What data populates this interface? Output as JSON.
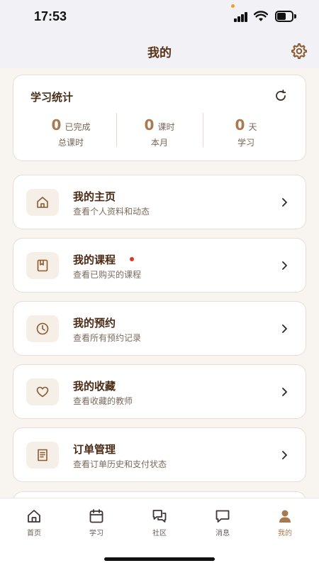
{
  "status": {
    "time": "17:53"
  },
  "header": {
    "title": "我的",
    "settings_icon": "gear-icon"
  },
  "stats": {
    "title": "学习统计",
    "items": [
      {
        "value": "0",
        "unit": "已完成",
        "label": "总课时"
      },
      {
        "value": "0",
        "unit": "课时",
        "label": "本月"
      },
      {
        "value": "0",
        "unit": "天",
        "label": "学习"
      }
    ]
  },
  "menu": [
    {
      "title": "我的主页",
      "subtitle": "查看个人资料和动态",
      "icon": "home-icon"
    },
    {
      "title": "我的课程",
      "subtitle": "查看已购买的课程",
      "icon": "book-icon",
      "badge": true
    },
    {
      "title": "我的预约",
      "subtitle": "查看所有预约记录",
      "icon": "clock-icon"
    },
    {
      "title": "我的收藏",
      "subtitle": "查看收藏的教师",
      "icon": "heart-icon"
    },
    {
      "title": "订单管理",
      "subtitle": "查看订单历史和支付状态",
      "icon": "receipt-icon"
    }
  ],
  "tabs": [
    {
      "label": "首页",
      "icon": "home-icon"
    },
    {
      "label": "学习",
      "icon": "calendar-icon"
    },
    {
      "label": "社区",
      "icon": "chat-bubbles-icon"
    },
    {
      "label": "消息",
      "icon": "message-icon"
    },
    {
      "label": "我的",
      "icon": "person-icon",
      "active": true
    }
  ],
  "colors": {
    "accent": "#a87a52",
    "title_brown": "#5a3418",
    "badge_red": "#d63a2a"
  }
}
